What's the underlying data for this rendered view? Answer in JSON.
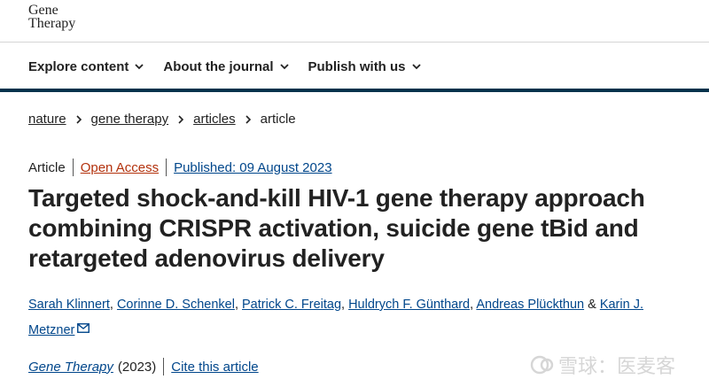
{
  "header": {
    "logo_line1": "Gene",
    "logo_line2": "Therapy"
  },
  "nav": {
    "items": [
      {
        "label": "Explore content"
      },
      {
        "label": "About the journal"
      },
      {
        "label": "Publish with us"
      }
    ]
  },
  "breadcrumb": {
    "items": [
      "nature",
      "gene therapy",
      "articles",
      "article"
    ]
  },
  "meta": {
    "type": "Article",
    "access": "Open Access",
    "published": "Published: 09 August 2023"
  },
  "article": {
    "title": "Targeted shock-and-kill HIV-1 gene therapy approach combining CRISPR activation, suicide gene tBid and retargeted adenovirus delivery",
    "authors": [
      "Sarah Klinnert",
      "Corinne D. Schenkel",
      "Patrick C. Freitag",
      "Huldrych F. Günthard",
      "Andreas Plückthun",
      "Karin J. Metzner"
    ],
    "separator": ",",
    "last_separator": "&"
  },
  "citation": {
    "journal": "Gene Therapy",
    "year": "(2023)",
    "cite_label": "Cite this article"
  },
  "watermark": {
    "text": "雪球：医麦客"
  },
  "colors": {
    "link": "#00468b",
    "open_access": "#b3320d",
    "navbar_line": "#01324b"
  }
}
